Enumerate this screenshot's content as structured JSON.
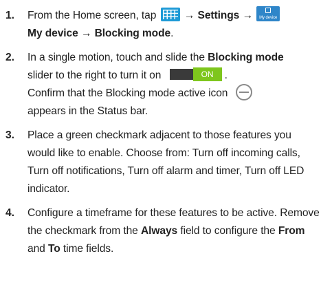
{
  "steps": [
    {
      "number": "1.",
      "intro": "From the Home screen, tap",
      "arrow1": "→",
      "settings": "Settings",
      "arrow2": "→",
      "my_device_icon_label": "My device",
      "my_device": "My device",
      "arrow3": "→",
      "blocking_mode": "Blocking mode",
      "end": "."
    },
    {
      "number": "2.",
      "p1_pre": "In a single motion, touch and slide the",
      "p1_bold": "Blocking mode",
      "p1_post": "slider to the right to turn it on",
      "toggle_label": "ON",
      "p1_end": ".",
      "p2": "Confirm that the Blocking mode active icon",
      "p2_end": "appears in the Status bar."
    },
    {
      "number": "3.",
      "text": "Place a green checkmark adjacent to those features you would like to enable. Choose from: Turn off incoming calls, Turn off notifications, Turn off alarm and timer, Turn off LED indicator."
    },
    {
      "number": "4.",
      "pre": "Configure a timeframe for these features to be active. Remove the checkmark from the",
      "always": "Always",
      "mid": "field to configure the",
      "from": "From",
      "and": "and",
      "to": "To",
      "end": "time fields."
    }
  ],
  "colors": {
    "apps_icon": "#1e9ad6",
    "my_device_icon": "#2f86c9",
    "toggle_on": "#7ec61d",
    "toggle_off": "#3a3a3a"
  },
  "icons": [
    "apps-grid-icon",
    "my-device-icon",
    "on-toggle-icon",
    "blocking-mode-icon"
  ]
}
